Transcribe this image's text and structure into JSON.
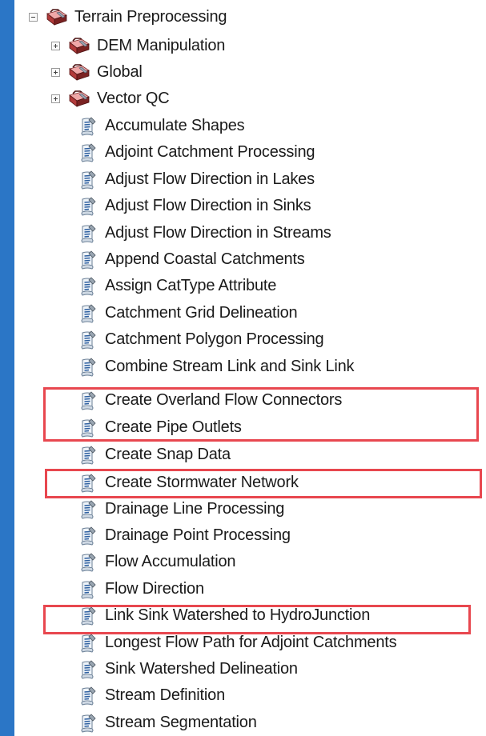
{
  "tree": {
    "root": {
      "label": "Terrain Preprocessing",
      "expander": "minus",
      "icon": "toolbox-icon"
    },
    "toolsets": [
      {
        "label": "DEM Manipulation",
        "expander": "plus",
        "icon": "toolbox-icon"
      },
      {
        "label": "Global",
        "expander": "plus",
        "icon": "toolbox-icon"
      },
      {
        "label": "Vector QC",
        "expander": "plus",
        "icon": "toolbox-icon"
      }
    ],
    "tools": [
      {
        "label": "Accumulate Shapes",
        "icon": "script-tool-icon"
      },
      {
        "label": "Adjoint Catchment Processing",
        "icon": "script-tool-icon"
      },
      {
        "label": "Adjust Flow Direction in Lakes",
        "icon": "script-tool-icon"
      },
      {
        "label": "Adjust Flow Direction in Sinks",
        "icon": "script-tool-icon"
      },
      {
        "label": "Adjust Flow Direction in Streams",
        "icon": "script-tool-icon"
      },
      {
        "label": "Append Coastal Catchments",
        "icon": "script-tool-icon"
      },
      {
        "label": "Assign CatType Attribute",
        "icon": "script-tool-icon"
      },
      {
        "label": "Catchment Grid Delineation",
        "icon": "script-tool-icon"
      },
      {
        "label": "Catchment Polygon Processing",
        "icon": "script-tool-icon"
      },
      {
        "label": "Combine Stream Link and Sink Link",
        "icon": "script-tool-icon"
      },
      {
        "label": "Create Overland Flow Connectors",
        "icon": "script-tool-icon"
      },
      {
        "label": "Create Pipe Outlets",
        "icon": "script-tool-icon"
      },
      {
        "label": "Create Snap Data",
        "icon": "script-tool-icon"
      },
      {
        "label": "Create Stormwater Network",
        "icon": "script-tool-icon"
      },
      {
        "label": "Drainage Line Processing",
        "icon": "script-tool-icon"
      },
      {
        "label": "Drainage Point Processing",
        "icon": "script-tool-icon"
      },
      {
        "label": "Flow Accumulation",
        "icon": "script-tool-icon"
      },
      {
        "label": "Flow Direction",
        "icon": "script-tool-icon"
      },
      {
        "label": "Link Sink Watershed to HydroJunction",
        "icon": "script-tool-icon"
      },
      {
        "label": "Longest Flow Path for Adjoint Catchments",
        "icon": "script-tool-icon"
      },
      {
        "label": "Sink Watershed Delineation",
        "icon": "script-tool-icon"
      },
      {
        "label": "Stream Definition",
        "icon": "script-tool-icon"
      },
      {
        "label": "Stream Segmentation",
        "icon": "script-tool-icon"
      }
    ]
  },
  "colors": {
    "background": "#2b76c6",
    "panel": "#ffffff",
    "highlight": "#e8474f"
  }
}
